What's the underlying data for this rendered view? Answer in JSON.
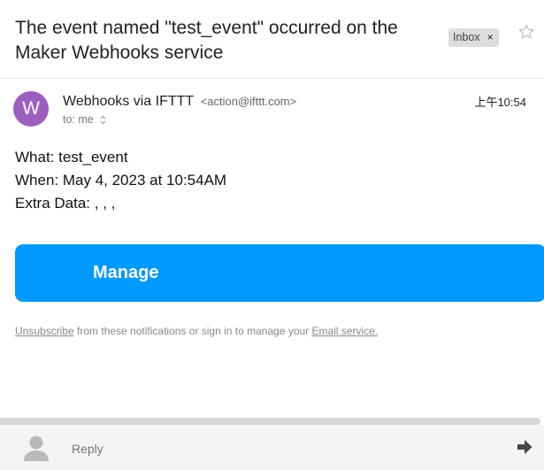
{
  "email": {
    "subject": "The event named \"test_event\" occurred on the Maker Webhooks service",
    "label": "Inbox",
    "label_close": "×",
    "avatar_letter": "W",
    "sender_name": "Webhooks via IFTTT",
    "sender_email": "<action@ifttt.com>",
    "to": "to: me",
    "time": "上午10:54"
  },
  "body": {
    "what": "What: test_event",
    "when": "When: May 4, 2023 at 10:54AM",
    "extra": "Extra Data: , , ,"
  },
  "manage_button": {
    "label": "Manage"
  },
  "footer": {
    "unsubscribe": "Unsubscribe",
    "middle": " from these notifications or sign in to manage your ",
    "service_link": "Email service."
  },
  "reply_bar": {
    "reply_label": "Reply"
  },
  "colors": {
    "avatar": "#9c5fc0",
    "manage_button": "#0099ff",
    "label_chip": "#dddddd"
  },
  "icons": [
    "star-icon",
    "chevron-updown-icon",
    "person-icon",
    "forward-arrow-icon",
    "close-icon"
  ]
}
